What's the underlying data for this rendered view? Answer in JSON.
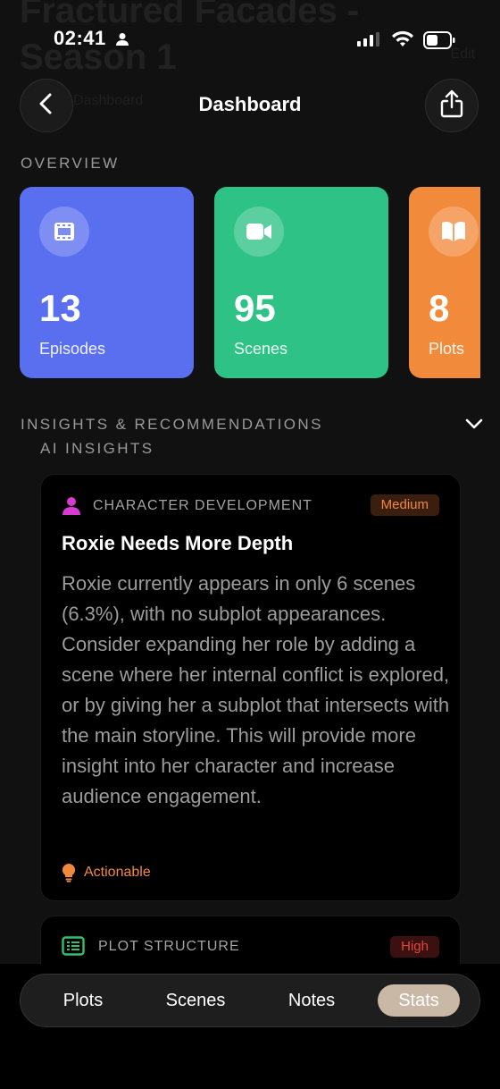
{
  "background": {
    "project_title": "Fractured Facades -\nSeason 1",
    "project_sub": "Dashboard",
    "project_meta": "Edit"
  },
  "status_bar": {
    "time": "02:41"
  },
  "header": {
    "title": "Dashboard"
  },
  "overview": {
    "label": "OVERVIEW",
    "cards": [
      {
        "value": "13",
        "label": "Episodes",
        "icon": "film-icon",
        "color": "#5a6ff0"
      },
      {
        "value": "95",
        "label": "Scenes",
        "icon": "video-camera-icon",
        "color": "#2ec286"
      },
      {
        "value": "8",
        "label": "Plots",
        "icon": "book-icon",
        "color": "#f28a3c"
      }
    ]
  },
  "insights": {
    "label": "INSIGHTS & RECOMMENDATIONS",
    "ai_label": "AI INSIGHTS",
    "items": [
      {
        "category": "CHARACTER DEVELOPMENT",
        "priority": "Medium",
        "title": "Roxie Needs More Depth",
        "body": "Roxie currently appears in only 6 scenes (6.3%), with no subplot appearances. Consider expanding her role by adding a scene where her internal conflict is explored, or by giving her a subplot that intersects with the main storyline. This will provide more insight into her character and increase audience engagement.",
        "tag": "Actionable"
      },
      {
        "category": "PLOT STRUCTURE",
        "priority": "High"
      }
    ]
  },
  "tabbar": {
    "tabs": [
      "Plots",
      "Scenes",
      "Notes",
      "Stats"
    ],
    "active": "Stats"
  },
  "colors": {
    "accent_orange": "#f0883e",
    "priority_high": "#e0463f",
    "active_tab": "#c9b8a6"
  }
}
